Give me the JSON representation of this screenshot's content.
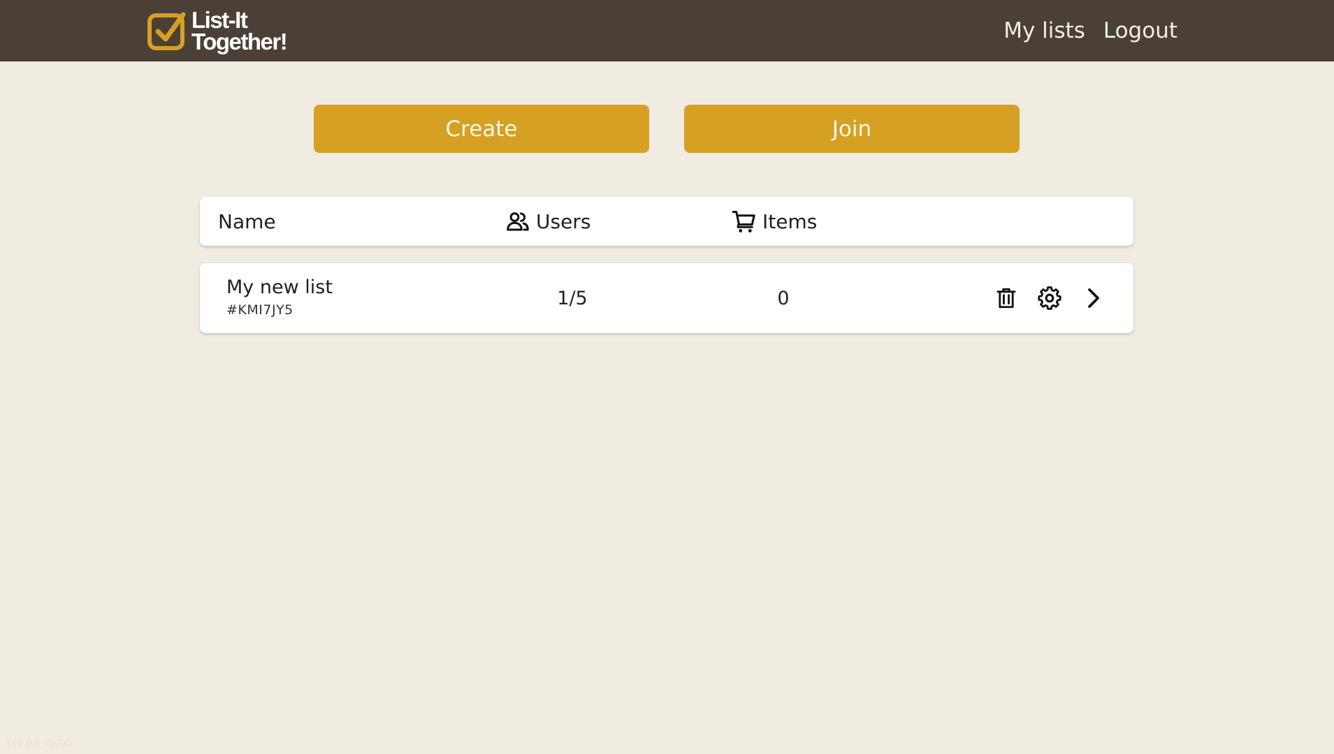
{
  "colors": {
    "topbar": "#4a4036",
    "background": "#f1ece1",
    "accent": "#d6a023",
    "card": "#ffffff"
  },
  "logo": {
    "line1": "List-It",
    "line2": "Together!",
    "icon": "checkbox-icon"
  },
  "nav": {
    "my_lists": "My lists",
    "logout": "Logout"
  },
  "actions": {
    "create_label": "Create",
    "join_label": "Join"
  },
  "table": {
    "headers": {
      "name": "Name",
      "users": "Users",
      "items": "Items"
    },
    "header_icons": {
      "users": "users-icon",
      "items": "cart-icon"
    },
    "rows": [
      {
        "name": "My new list",
        "code": "#KMI7JY5",
        "users": "1/5",
        "items": "0",
        "row_actions": [
          "trash-icon",
          "gear-icon",
          "chevron-right-icon"
        ]
      }
    ]
  },
  "footer": {
    "version_text": "167.0.0 v5000"
  }
}
